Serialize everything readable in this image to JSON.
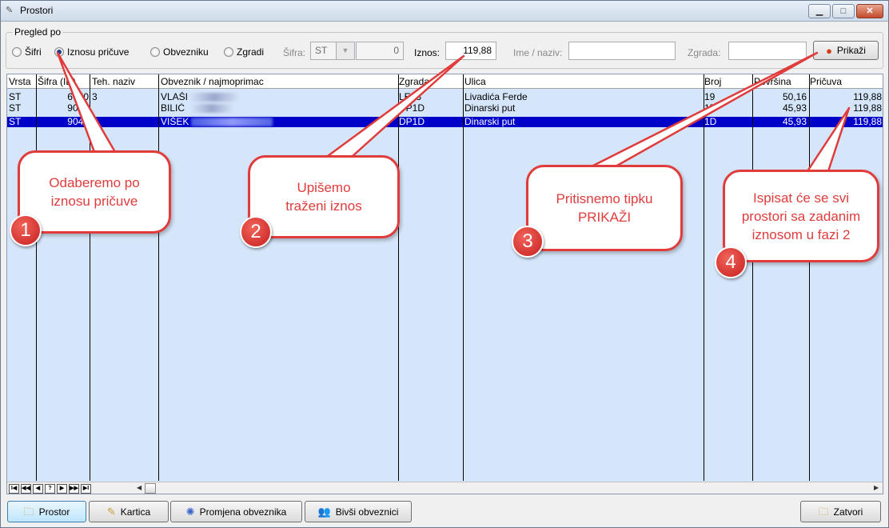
{
  "window": {
    "title": "Prostori",
    "min": "▁",
    "max": "□",
    "close": "✕"
  },
  "filters": {
    "group_label": "Pregled po",
    "radios": [
      {
        "label": "Šifri",
        "checked": false
      },
      {
        "label": "Iznosu pričuve",
        "checked": true
      },
      {
        "label": "Obvezniku",
        "checked": false
      },
      {
        "label": "Zgradi",
        "checked": false
      }
    ],
    "sifra_label": "Šifra:",
    "sifra_value": "ST",
    "sifra_number": "0",
    "iznos_label": "Iznos:",
    "iznos_value": "119,88",
    "ime_label": "Ime / naziv:",
    "ime_value": "",
    "zgrada_label": "Zgrada:",
    "zgrada_value": "",
    "show_button": "Prikaži"
  },
  "grid": {
    "headers": [
      "Vrsta",
      "Šifra (ID)",
      "Teh. naziv",
      "Obveznik / najmoprimac",
      "Zgrada",
      "Ulica",
      "Broj",
      "Površina",
      "Pričuva"
    ],
    "rows": [
      {
        "vrsta": "ST",
        "sifra": "6650",
        "teh": "3",
        "obveznik": "VLAŠI",
        "zgrada": "LE13",
        "ulica": "Livadića Ferde",
        "broj": "19",
        "povrsina": "50,16",
        "pricuva": "119,88",
        "selected": false
      },
      {
        "vrsta": "ST",
        "sifra": "9035",
        "teh": "",
        "obveznik": "BILIĆ",
        "zgrada": "DP1D",
        "ulica": "Dinarski put",
        "broj": "1D",
        "povrsina": "45,93",
        "pricuva": "119,88",
        "selected": false
      },
      {
        "vrsta": "ST",
        "sifra": "9041",
        "teh": "",
        "obveznik": "VIŠEK",
        "zgrada": "DP1D",
        "ulica": "Dinarski put",
        "broj": "1D",
        "povrsina": "45,93",
        "pricuva": "119,88",
        "selected": true
      }
    ],
    "nav": [
      "I◀",
      "◀◀",
      "◀",
      "?",
      "▶",
      "▶▶",
      "▶I"
    ]
  },
  "buttons": {
    "prostor": "Prostor",
    "kartica": "Kartica",
    "promjena": "Promjena obveznika",
    "bivsi": "Bivši obveznici",
    "zatvori": "Zatvori"
  },
  "callouts": [
    {
      "number": "1",
      "text": "Odaberemo po iznosu pričuve"
    },
    {
      "number": "2",
      "text": "Upišemo traženi iznos"
    },
    {
      "number": "3",
      "text": "Pritisnemo tipku PRIKAŽI"
    },
    {
      "number": "4",
      "text": "Ispisat će se svi prostori sa zadanim iznosom u fazi 2"
    }
  ],
  "colors": {
    "accent": "#e03c3c",
    "grid_bg": "#d6e6fa",
    "selection": "#0000c8"
  }
}
